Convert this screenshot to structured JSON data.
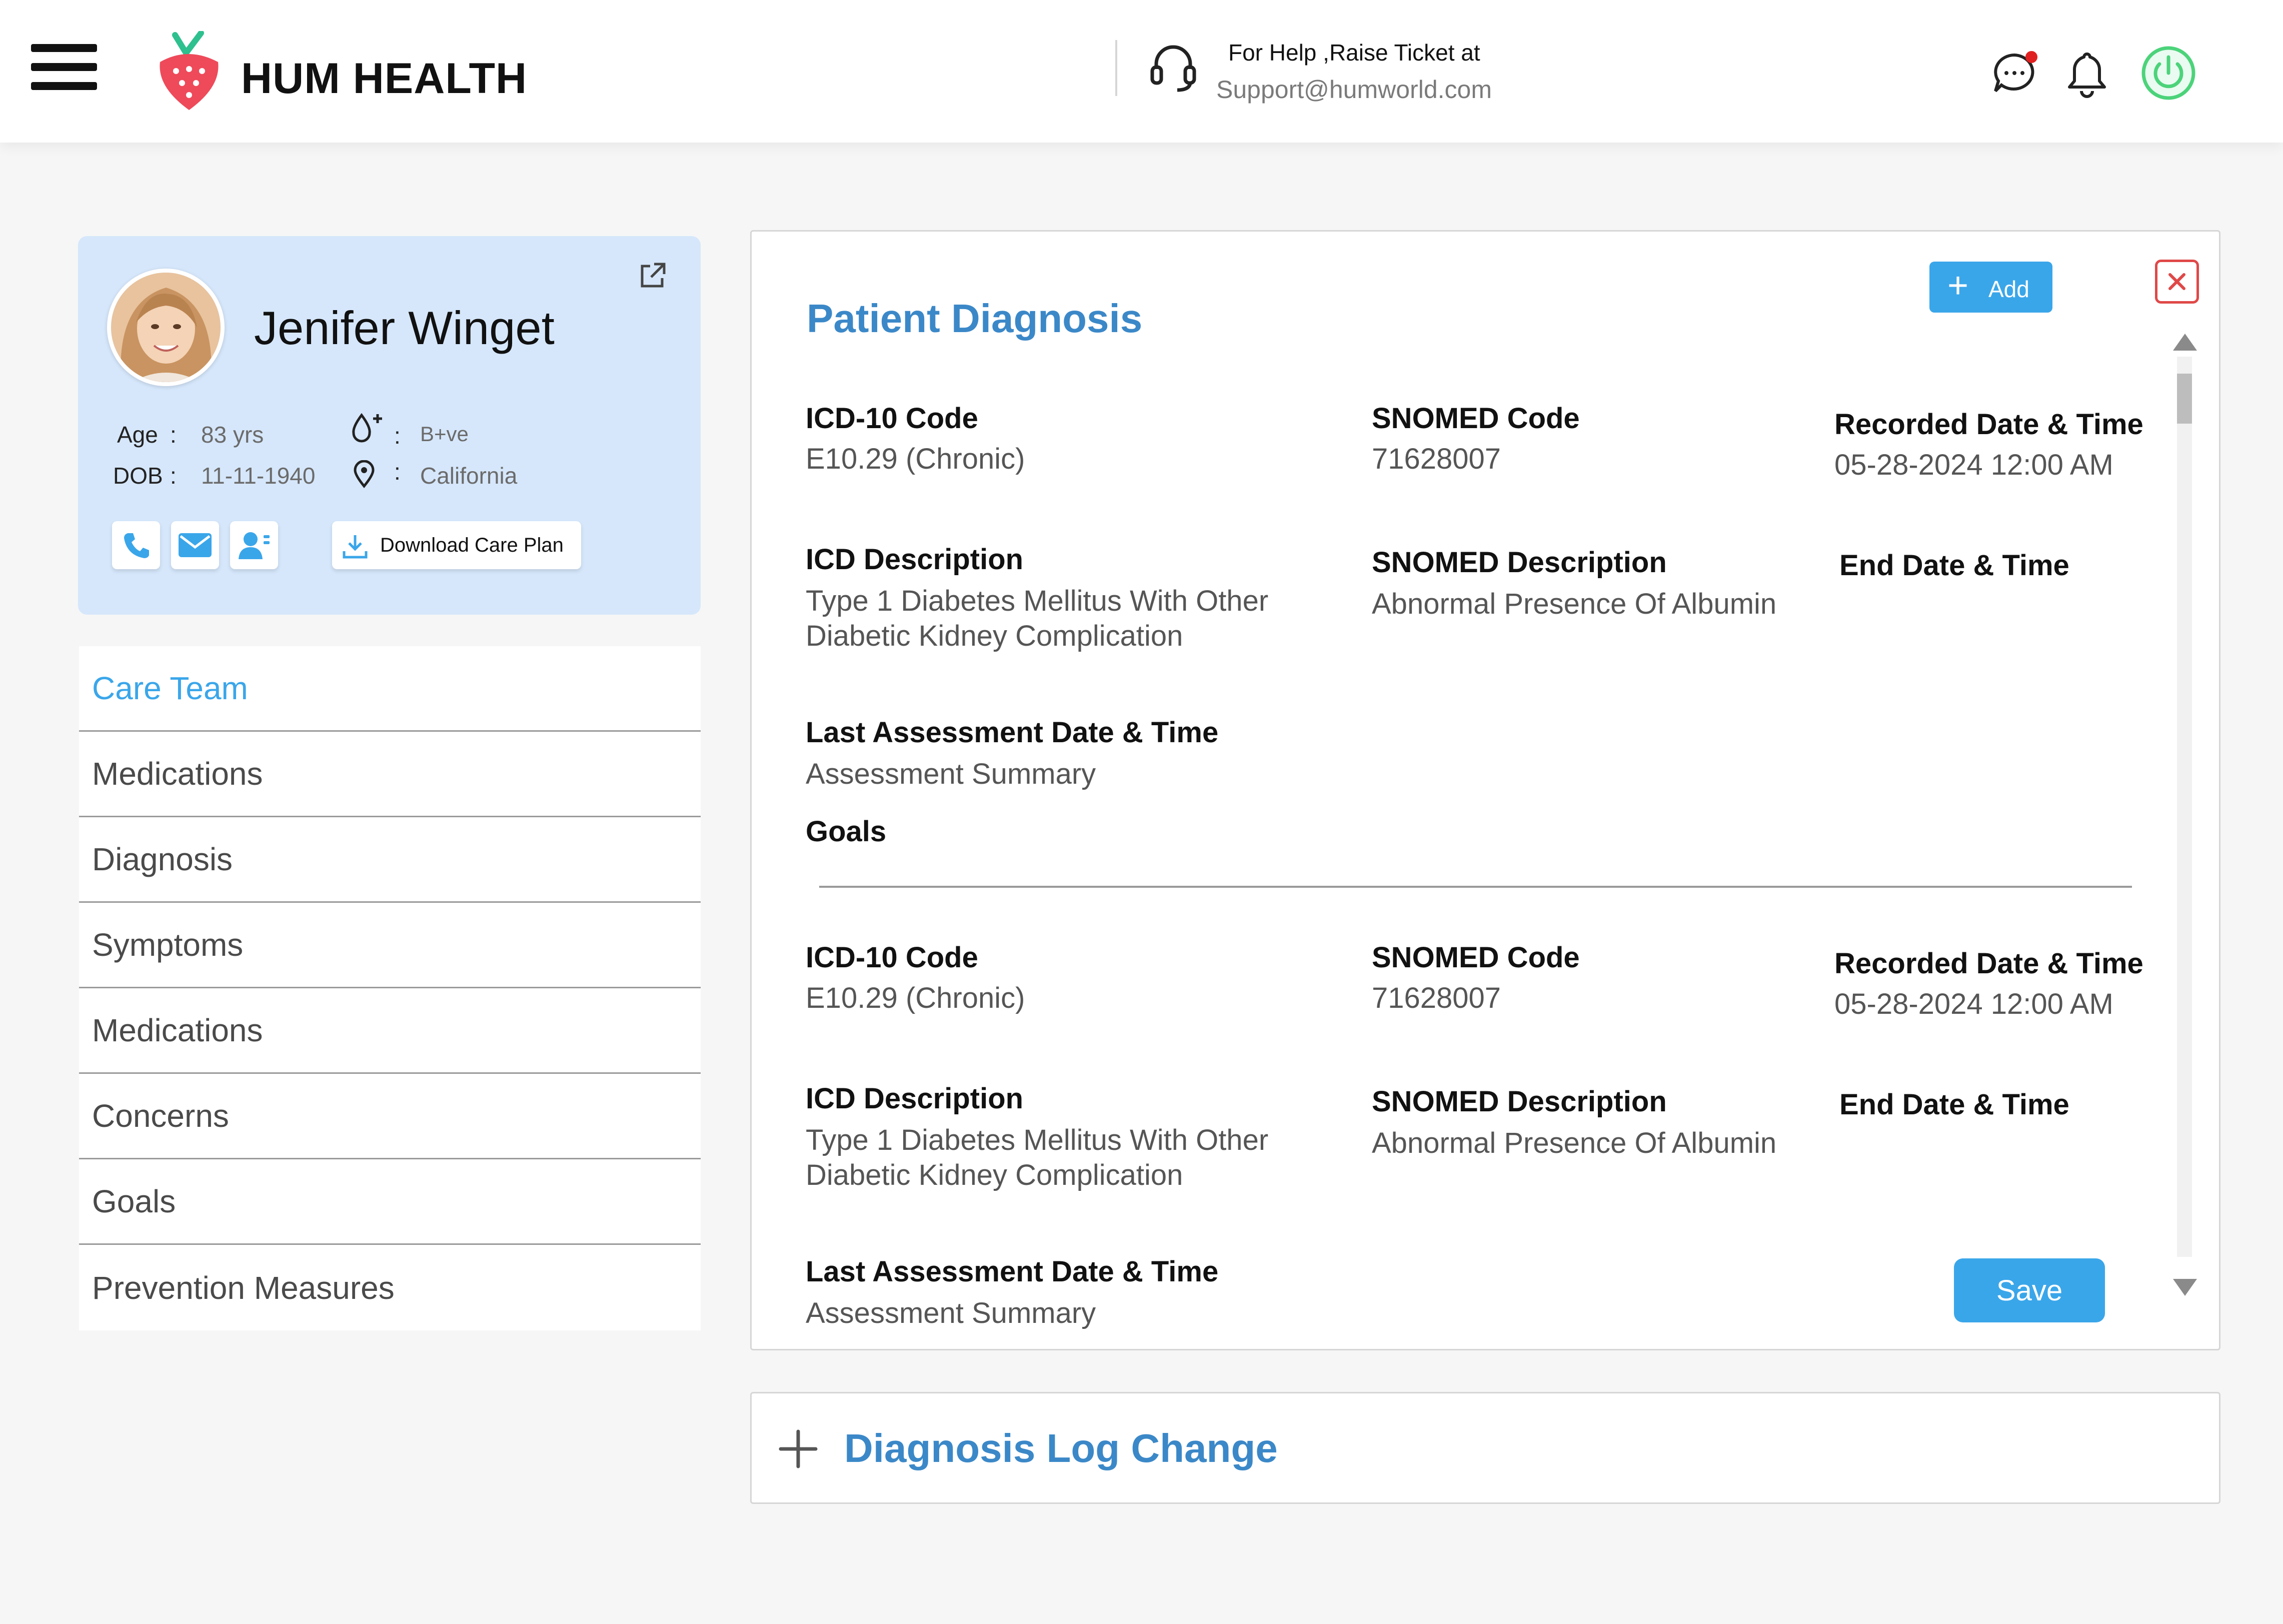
{
  "header": {
    "brand": "HUM HEALTH",
    "help_line1": "For Help ,Raise Ticket at",
    "help_line2": "Support@humworld.com",
    "icons": [
      "menu-icon",
      "strawberry-logo-icon",
      "headset-icon",
      "chat-icon",
      "bell-icon",
      "power-icon"
    ],
    "notification_dot_color": "#e02020",
    "power_color": "#4cd37a"
  },
  "patient": {
    "name": "Jenifer Winget",
    "age_label": "Age",
    "age_value": "83 yrs",
    "dob_label": "DOB",
    "dob_value": "11-11-1940",
    "colon": ":",
    "blood_group": "B+ve",
    "location": "California",
    "download_label": "Download Care Plan",
    "action_icons": [
      "phone-icon",
      "mail-icon",
      "contact-icon"
    ]
  },
  "menu": {
    "items": [
      {
        "label": "Care Team",
        "active": true
      },
      {
        "label": "Medications",
        "active": false
      },
      {
        "label": "Diagnosis",
        "active": false
      },
      {
        "label": "Symptoms",
        "active": false
      },
      {
        "label": "Medications",
        "active": false
      },
      {
        "label": "Concerns",
        "active": false
      },
      {
        "label": "Goals",
        "active": false
      },
      {
        "label": "Prevention Measures",
        "active": false
      }
    ]
  },
  "diagnosis": {
    "title": "Patient Diagnosis",
    "add_label": "Add",
    "save_label": "Save",
    "labels": {
      "icd_code": "ICD-10 Code",
      "snomed_code": "SNOMED Code",
      "recorded": "Recorded Date & Time",
      "icd_desc": "ICD Description",
      "snomed_desc": "SNOMED Description",
      "end_date": "End Date & Time",
      "last_assessment": "Last Assessment Date & Time",
      "goals": "Goals"
    },
    "entries": [
      {
        "icd_code": "E10.29 (Chronic)",
        "snomed_code": "71628007",
        "recorded": "05-28-2024 12:00 AM",
        "icd_desc_line1": "Type 1 Diabetes Mellitus With Other",
        "icd_desc_line2": "Diabetic Kidney Complication",
        "snomed_desc": "Abnormal Presence Of Albumin",
        "assessment": "Assessment Summary"
      },
      {
        "icd_code": "E10.29 (Chronic)",
        "snomed_code": "71628007",
        "recorded": "05-28-2024 12:00 AM",
        "icd_desc_line1": "Type 1 Diabetes Mellitus With Other",
        "icd_desc_line2": "Diabetic Kidney Complication",
        "snomed_desc": "Abnormal Presence Of Albumin",
        "assessment": "Assessment Summary"
      }
    ]
  },
  "log_change": {
    "title": "Diagnosis Log Change"
  },
  "colors": {
    "accent": "#3aa6ea",
    "title_blue": "#3b88c8",
    "card_bg": "#d6e7fb",
    "close_red": "#e04848"
  }
}
